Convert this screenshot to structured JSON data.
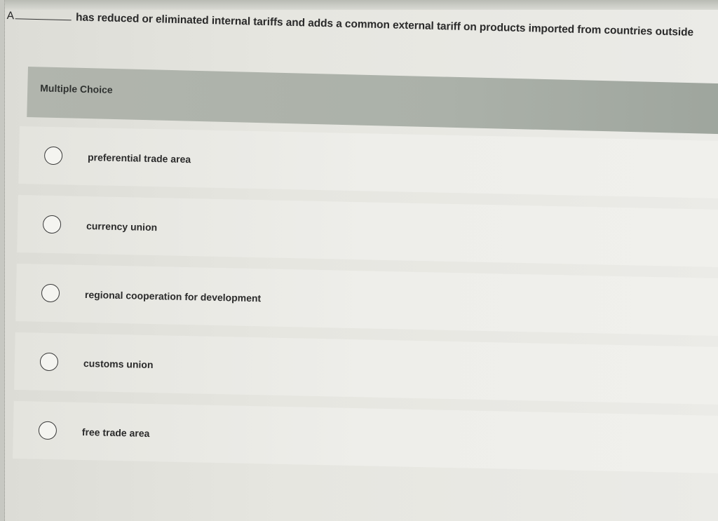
{
  "question": {
    "prefix": "A",
    "stem": "has reduced or eliminated internal tariffs and adds a common external tariff on products imported from countries outside"
  },
  "mc_label": "Multiple Choice",
  "choices": [
    {
      "label": "preferential trade area"
    },
    {
      "label": "currency union"
    },
    {
      "label": "regional cooperation for development"
    },
    {
      "label": "customs union"
    },
    {
      "label": "free trade area"
    }
  ]
}
